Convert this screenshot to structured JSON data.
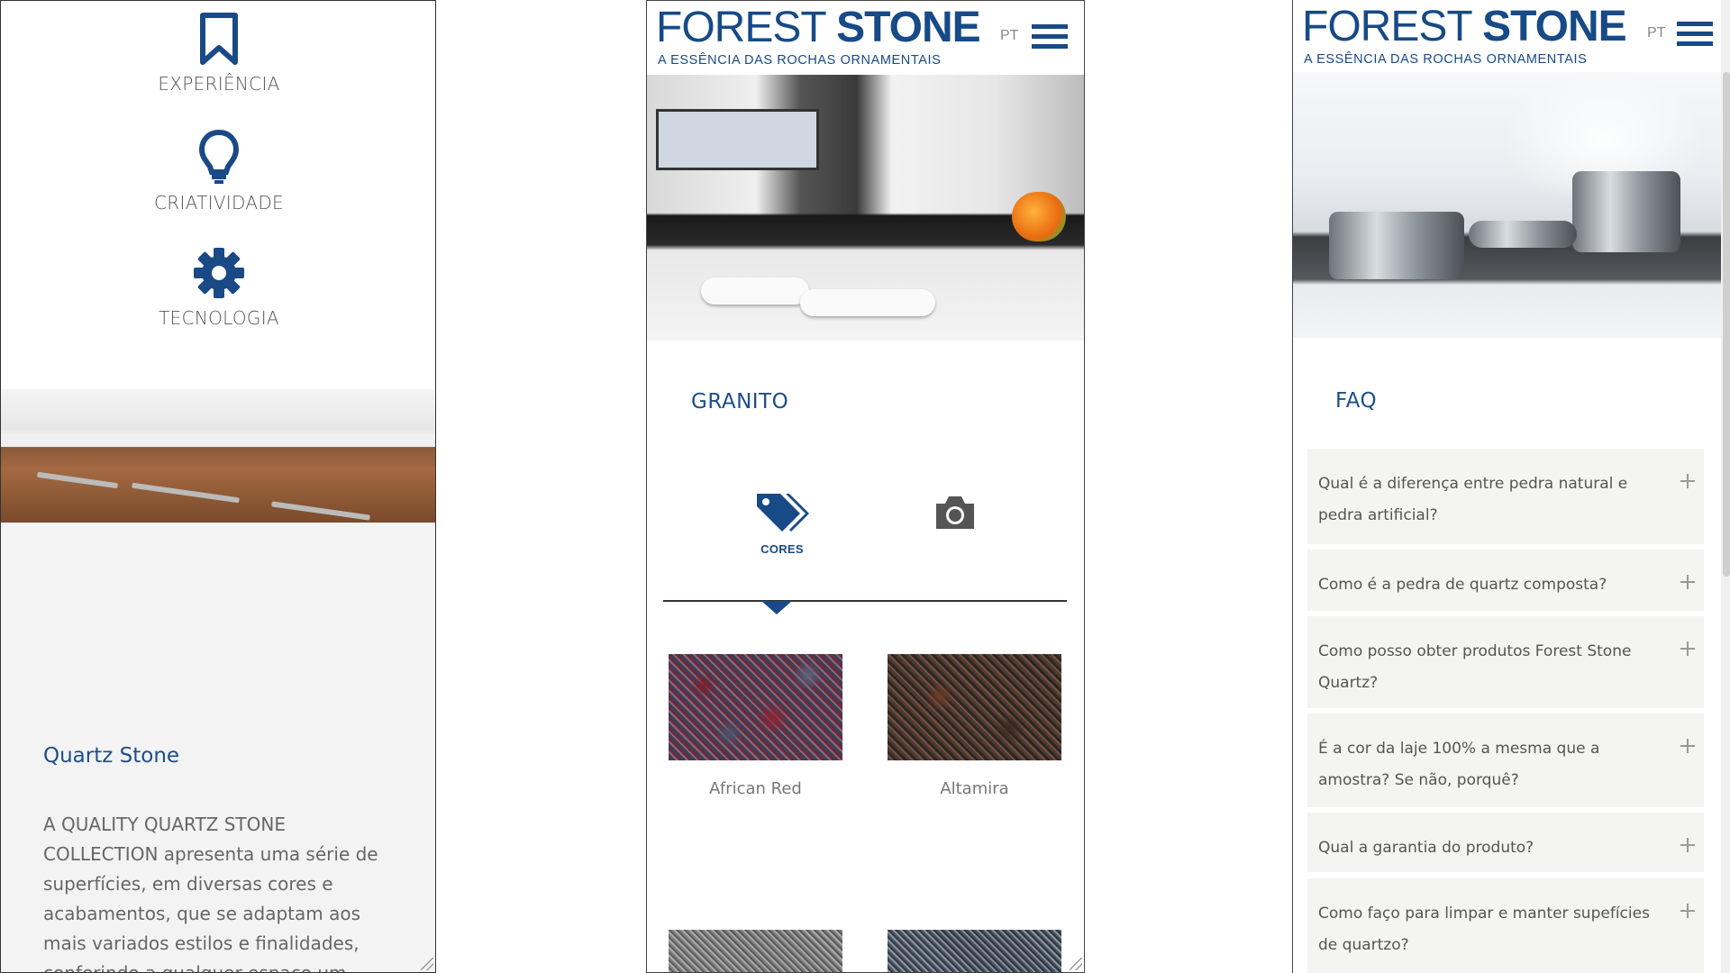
{
  "panel1": {
    "features": [
      {
        "icon": "bookmark-icon",
        "label": "EXPERIÊNCIA"
      },
      {
        "icon": "lightbulb-icon",
        "label": "CRIATIVIDADE"
      },
      {
        "icon": "gear-icon",
        "label": "TECNOLOGIA"
      }
    ],
    "section_title": "Quartz Stone",
    "section_body": "A QUALITY QUARTZ STONE COLLECTION apresenta uma série de superfícies, em diversas cores e acabamentos, que se adaptam aos mais variados estilos e finalidades, conferindo a qualquer espaço um"
  },
  "brand": {
    "name_part1": "FOREST",
    "name_part2": "STONE",
    "tagline": "A ESSÊNCIA DAS ROCHAS ORNAMENTAIS",
    "lang": "PT",
    "color": "#174a86"
  },
  "panel2": {
    "section_title": "GRANITO",
    "tabs": [
      {
        "icon": "tags-icon",
        "label": "CORES",
        "active": true
      },
      {
        "icon": "camera-icon",
        "label": "",
        "active": false
      }
    ],
    "swatches": [
      {
        "name": "African Red"
      },
      {
        "name": "Altamira"
      }
    ]
  },
  "panel3": {
    "section_title": "FAQ",
    "faq": [
      {
        "question": "Qual é a diferença entre pedra natural e pedra artificial?"
      },
      {
        "question": "Como é a pedra de quartz composta?"
      },
      {
        "question": "Como posso obter produtos Forest Stone Quartz?"
      },
      {
        "question": "É a cor da laje 100% a mesma que a amostra? Se não, porquê?"
      },
      {
        "question": "Qual a garantia do produto?"
      },
      {
        "question": "Como faço para limpar e manter supefícies de quartzo?"
      }
    ]
  }
}
